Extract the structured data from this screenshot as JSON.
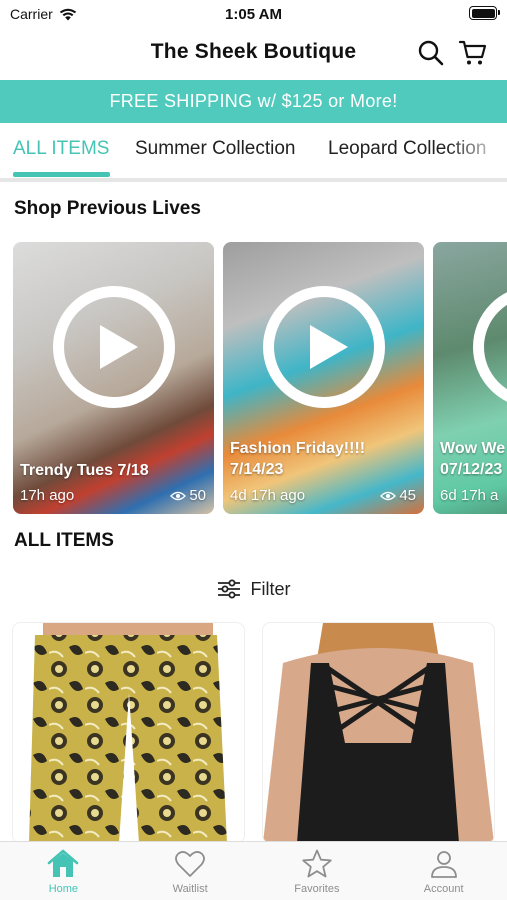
{
  "status_bar": {
    "carrier": "Carrier",
    "time": "1:05 AM"
  },
  "header": {
    "title": "The Sheek Boutique",
    "icons": [
      "search-icon",
      "cart-icon"
    ]
  },
  "promo": {
    "text": "FREE SHIPPING w/ $125 or More!"
  },
  "tabs": [
    {
      "label": "ALL ITEMS",
      "active": true
    },
    {
      "label": "Summer Collection",
      "active": false
    },
    {
      "label": "Leopard Collection",
      "active": false
    }
  ],
  "previous_lives": {
    "title": "Shop Previous Lives",
    "items": [
      {
        "title": "Trendy Tues 7/18",
        "ago": "17h ago",
        "views": "50"
      },
      {
        "title": "Fashion Friday!!!!",
        "subtitle": "7/14/23",
        "ago": "4d 17h ago",
        "views": "45"
      },
      {
        "title": "Wow We",
        "subtitle": "07/12/23",
        "ago": "6d 17h a",
        "views": ""
      }
    ]
  },
  "all_items": {
    "title": "ALL ITEMS",
    "filter_label": "Filter"
  },
  "tab_bar": [
    {
      "label": "Home",
      "icon": "home-icon",
      "active": true
    },
    {
      "label": "Waitlist",
      "icon": "heart-icon",
      "active": false
    },
    {
      "label": "Favorites",
      "icon": "star-icon",
      "active": false
    },
    {
      "label": "Account",
      "icon": "person-icon",
      "active": false
    }
  ],
  "colors": {
    "accent": "#45c4b5",
    "promo_bg": "#4fcabd",
    "inactive": "#8e8e8e"
  }
}
